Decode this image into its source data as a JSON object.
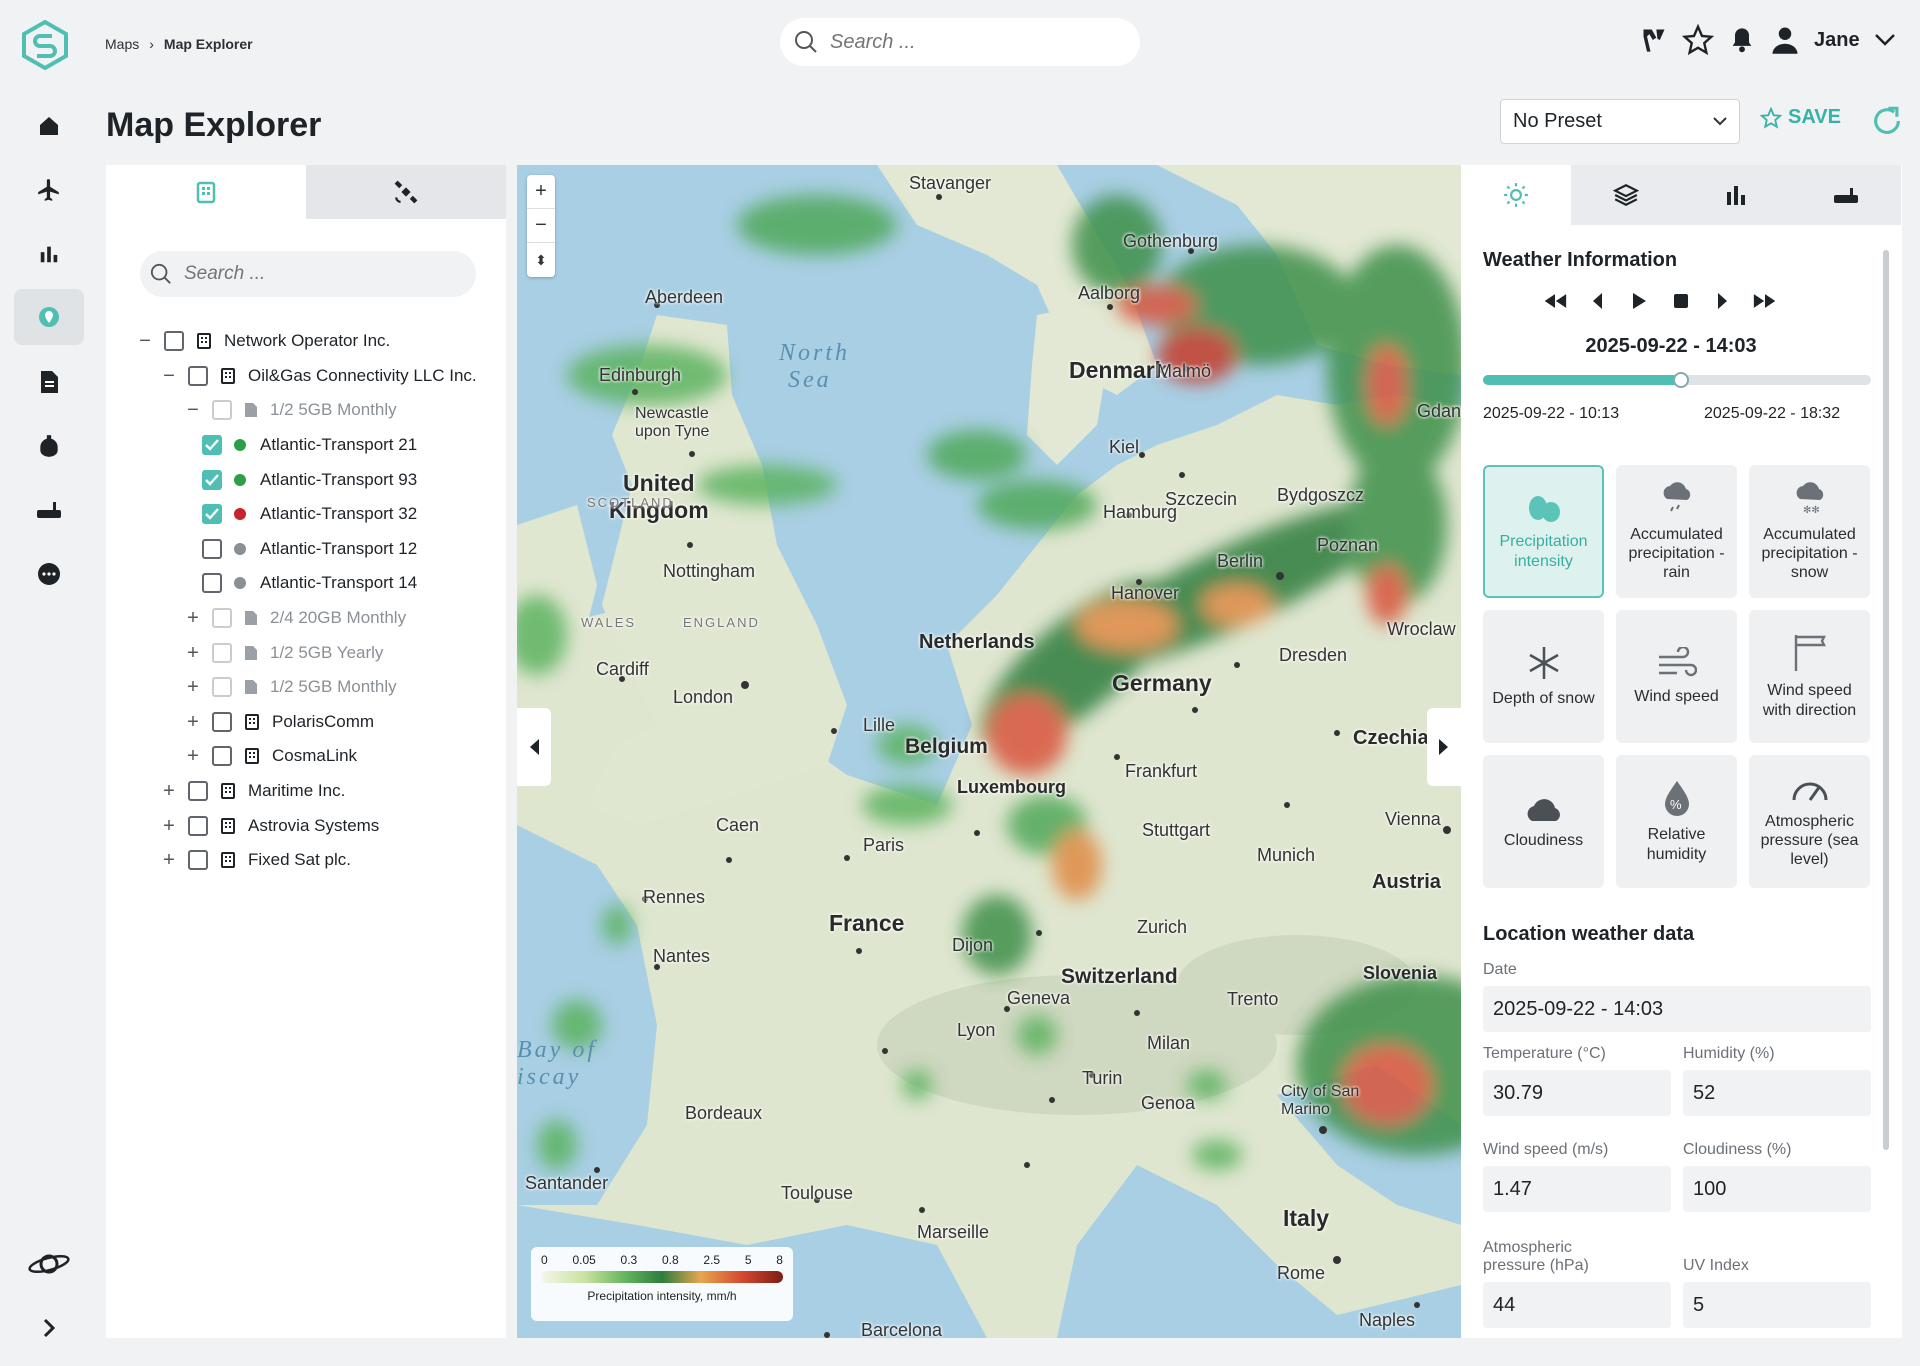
{
  "breadcrumb": {
    "root": "Maps",
    "current": "Map Explorer"
  },
  "search": {
    "placeholder": "Search ..."
  },
  "user": {
    "name": "Jane"
  },
  "page": {
    "title": "Map Explorer"
  },
  "preset": {
    "value": "No Preset"
  },
  "save_label": "SAVE",
  "tree": {
    "search_placeholder": "Search ...",
    "rows": [
      {
        "label": "Network Operator Inc.",
        "toggle": "−",
        "type": "org",
        "checked": false,
        "dim": false
      },
      {
        "label": "Oil&Gas Connectivity LLC Inc.",
        "toggle": "−",
        "type": "org",
        "checked": false,
        "dim": false
      },
      {
        "label": "1/2 5GB Monthly",
        "toggle": "−",
        "type": "plan",
        "checked": false,
        "dim": true
      },
      {
        "label": "Atlantic-Transport 21",
        "toggle": "",
        "type": "terminal",
        "checked": true,
        "status": "#2e9e48"
      },
      {
        "label": "Atlantic-Transport 93",
        "toggle": "",
        "type": "terminal",
        "checked": true,
        "status": "#2e9e48"
      },
      {
        "label": "Atlantic-Transport 32",
        "toggle": "",
        "type": "terminal",
        "checked": true,
        "status": "#c8232c"
      },
      {
        "label": "Atlantic-Transport 12",
        "toggle": "",
        "type": "terminal",
        "checked": false,
        "status": "#8a8f94"
      },
      {
        "label": "Atlantic-Transport 14",
        "toggle": "",
        "type": "terminal",
        "checked": false,
        "status": "#8a8f94"
      },
      {
        "label": "2/4 20GB Monthly",
        "toggle": "+",
        "type": "plan",
        "checked": false,
        "dim": true
      },
      {
        "label": "1/2 5GB Yearly",
        "toggle": "+",
        "type": "plan",
        "checked": false,
        "dim": true
      },
      {
        "label": "1/2 5GB Monthly",
        "toggle": "+",
        "type": "plan",
        "checked": false,
        "dim": true
      },
      {
        "label": "PolarisComm",
        "toggle": "+",
        "type": "org",
        "checked": false,
        "dim": false
      },
      {
        "label": "CosmaLink",
        "toggle": "+",
        "type": "org",
        "checked": false,
        "dim": false
      },
      {
        "label": "Maritime Inc.",
        "toggle": "+",
        "type": "org",
        "checked": false,
        "dim": false
      },
      {
        "label": "Astrovia Systems",
        "toggle": "+",
        "type": "org",
        "checked": false,
        "dim": false
      },
      {
        "label": "Fixed Sat plc.",
        "toggle": "+",
        "type": "org",
        "checked": false,
        "dim": false
      }
    ]
  },
  "map": {
    "legend": {
      "ticks": [
        "0",
        "0.05",
        "0.3",
        "0.8",
        "2.5",
        "5",
        "8"
      ],
      "title": "Precipitation intensity, mm/h"
    },
    "countries": [
      "Denmark",
      "United Kingdom",
      "Netherlands",
      "Germany",
      "Belgium",
      "Luxembourg",
      "France",
      "Switzerland",
      "Czechia",
      "Austria",
      "Slovenia",
      "Italy"
    ],
    "seas": [
      "North Sea",
      "Bay of Biscay"
    ],
    "cities": [
      "Stavanger",
      "Gothenburg",
      "Aberdeen",
      "Aalborg",
      "Edinburgh",
      "Malmö",
      "Newcastle upon Tyne",
      "Kiel",
      "Szczecin",
      "Bydgoszcz",
      "Hamburg",
      "Gdansk",
      "Poznan",
      "Nottingham",
      "Berlin",
      "Hanover",
      "Wroclaw",
      "Cardiff",
      "London",
      "Dresden",
      "Lille",
      "Frankfurt",
      "Caen",
      "Paris",
      "Vienna",
      "Stuttgart",
      "Munich",
      "Rennes",
      "Nantes",
      "Dijon",
      "Zurich",
      "Geneva",
      "Trento",
      "Lyon",
      "Milan",
      "Turin",
      "Genoa",
      "Bordeaux",
      "City of San Marino",
      "Santander",
      "Toulouse",
      "Marseille",
      "Rome",
      "Naples",
      "Barcelona"
    ],
    "region_labels": [
      "SCOTLAND",
      "WALES",
      "ENGLAND"
    ]
  },
  "weather": {
    "title": "Weather Information",
    "current": "2025-09-22 - 14:03",
    "range_start": "2025-09-22 - 10:13",
    "range_end": "2025-09-22 - 18:32",
    "progress": 0.51,
    "tiles": [
      {
        "label": "Precipitation intensity",
        "icon": "precipitation-icon",
        "active": true
      },
      {
        "label": "Accumulated precipitation - rain",
        "icon": "rain-cloud-icon",
        "active": false
      },
      {
        "label": "Accumulated precipitation - snow",
        "icon": "snow-cloud-icon",
        "active": false
      },
      {
        "label": "Depth of snow",
        "icon": "snowflake-icon",
        "active": false
      },
      {
        "label": "Wind speed",
        "icon": "wind-icon",
        "active": false
      },
      {
        "label": "Wind speed with direction",
        "icon": "windsock-icon",
        "active": false
      },
      {
        "label": "Cloudiness",
        "icon": "cloud-icon",
        "active": false
      },
      {
        "label": "Relative humidity",
        "icon": "humidity-icon",
        "active": false
      },
      {
        "label": "Atmospheric pressure (sea level)",
        "icon": "gauge-icon",
        "active": false
      }
    ]
  },
  "location": {
    "title": "Location weather data",
    "date_label": "Date",
    "date": "2025-09-22 - 14:03",
    "temp_label": "Temperature (°C)",
    "temp": "30.79",
    "humidity_label": "Humidity (%)",
    "humidity": "52",
    "wind_label": "Wind speed (m/s)",
    "wind": "1.47",
    "cloud_label": "Cloudiness (%)",
    "cloud": "100",
    "pressure_label": "Atmospheric pressure (hPa)",
    "pressure": "44",
    "uv_label": "UV Index",
    "uv": "5"
  },
  "colors": {
    "accent": "#4fbfb3",
    "sea": "#a9cfe4",
    "land": "#dfe6cf"
  }
}
